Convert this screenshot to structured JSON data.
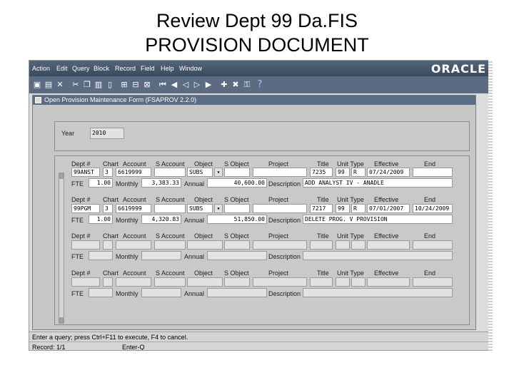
{
  "slide": {
    "title_line1": "Review Dept 99 Da.FIS",
    "title_line2": "PROVISION DOCUMENT"
  },
  "menu": [
    "Action",
    "Edit",
    "Query",
    "Block",
    "Record",
    "Field",
    "Help",
    "Window"
  ],
  "logo": "ORACLE",
  "window": {
    "title": "Open Provision Maintenance Form (FSAPROV 2.2.0)"
  },
  "year": {
    "label": "Year",
    "value": "2010"
  },
  "headers": {
    "dept": "Dept #",
    "chart": "Chart",
    "account": "Account",
    "saccount": "S Account",
    "object": "Object",
    "sobject": "S Object",
    "project": "Project",
    "title": "Title",
    "unittype": "Unit Type",
    "effective": "Effective",
    "end": "End",
    "fte": "FTE",
    "monthly": "Monthly",
    "annual": "Annual",
    "description": "Description"
  },
  "records": [
    {
      "dept": "99ANST",
      "chart": "3",
      "account": "6619999",
      "object": "SUBS",
      "title": "7235",
      "unit": "99",
      "type": "R",
      "effective": "07/24/2009",
      "end": "",
      "fte": "1.00",
      "monthly": "3,383.33",
      "annual": "40,600.00",
      "description": "ADD ANALYST IV - ANADLE"
    },
    {
      "dept": "99PGM",
      "chart": "3",
      "account": "6619999",
      "object": "SUBS",
      "title": "7217",
      "unit": "99",
      "type": "R",
      "effective": "07/01/2007",
      "end": "10/24/2009",
      "fte": "1.00",
      "monthly": "4,320.83",
      "annual": "51,850.00",
      "description": "DELETE PROG. V PROVISION"
    }
  ],
  "status": {
    "line1": "Enter a query; press Ctrl+F11 to execute, F4 to cancel.",
    "record": "Record: 1/1",
    "enter": "Enter-Q"
  },
  "help_mark": "?"
}
